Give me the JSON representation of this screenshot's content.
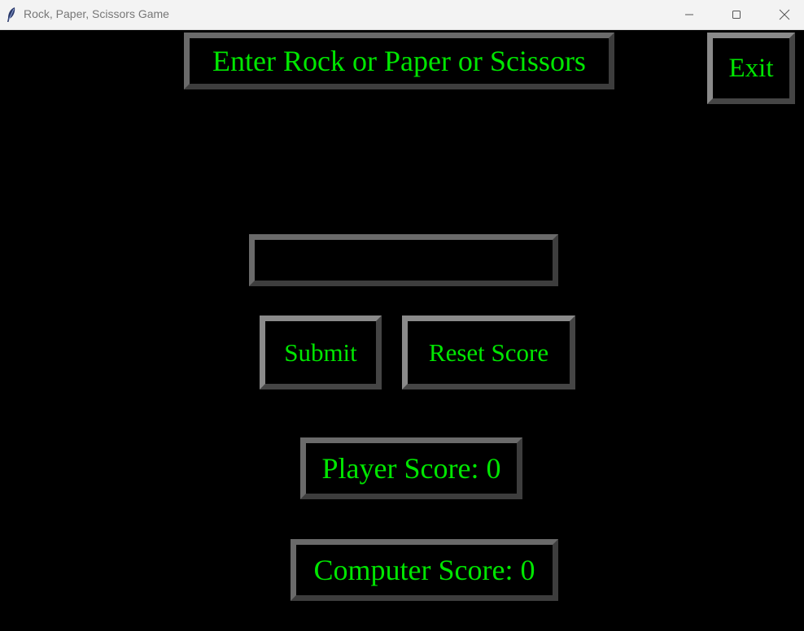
{
  "window": {
    "title": "Rock, Paper, Scissors Game",
    "icon": "feather-icon"
  },
  "titlebar_buttons": {
    "minimize_icon": "minimize-icon",
    "maximize_icon": "maximize-icon",
    "close_icon": "close-icon"
  },
  "app": {
    "heading": "Enter Rock or Paper or Scissors",
    "exit_label": "Exit",
    "input_value": "",
    "submit_label": "Submit",
    "reset_label": "Reset Score",
    "player_score_text": "Player Score: 0",
    "computer_score_text": "Computer Score: 0"
  },
  "colors": {
    "background": "#000000",
    "text": "#00e600",
    "border_light": "#6a6a6a",
    "border_dark": "#3d3d3d"
  }
}
